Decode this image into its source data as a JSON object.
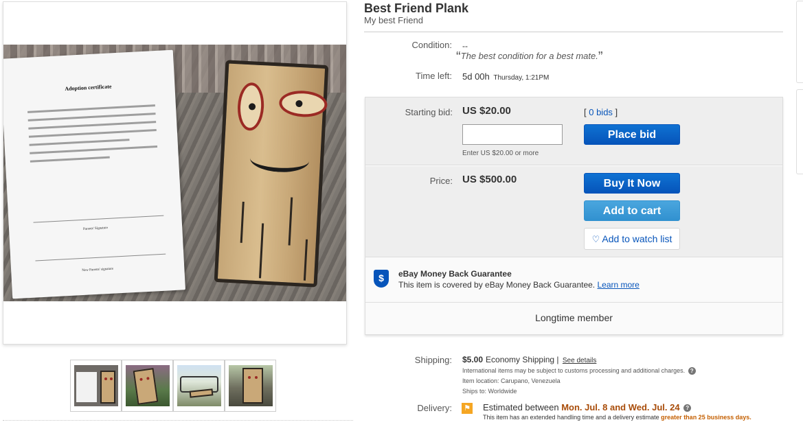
{
  "listing": {
    "title": "Best Friend Plank",
    "subtitle": "My best Friend"
  },
  "images": {
    "main": {
      "certificate_title": "Adoption certificate",
      "parents_signature": "Parents' Signature",
      "new_parents_signature": "New Parents' signature"
    },
    "thumbnails": [
      {
        "name": "certificate-and-plank"
      },
      {
        "name": "plank-in-garden"
      },
      {
        "name": "plank-on-bench"
      },
      {
        "name": "plank-on-balcony"
      }
    ]
  },
  "condition": {
    "label": "Condition:",
    "value": "--",
    "quote": "The best condition for a best mate."
  },
  "time_left": {
    "label": "Time left:",
    "value": "5d 00h",
    "detail": "Thursday, 1:21PM"
  },
  "bidding": {
    "label": "Starting bid:",
    "price": "US $20.00",
    "bids_link": "0 bids",
    "input_value": "",
    "hint": "Enter US $20.00 or more",
    "place_bid": "Place bid"
  },
  "buy": {
    "label": "Price:",
    "price": "US $500.00",
    "buy_it_now": "Buy It Now",
    "add_to_cart": "Add to cart",
    "watch_list": "Add to watch list"
  },
  "guarantee": {
    "title": "eBay Money Back Guarantee",
    "text": "This item is covered by eBay Money Back Guarantee.",
    "learn_more": "Learn more"
  },
  "seller": {
    "member": "Longtime member"
  },
  "shipping": {
    "label": "Shipping:",
    "cost": "$5.00",
    "method": "Economy Shipping",
    "details_link": "See details",
    "note": "International items may be subject to customs processing and additional charges.",
    "location": "Item location:  Carupano, Venezuela",
    "ships_to": "Ships to:  Worldwide"
  },
  "delivery": {
    "label": "Delivery:",
    "prefix": "Estimated between",
    "dates": "Mon. Jul. 8 and Wed. Jul. 24",
    "note_prefix": "This item has an extended handling time and a delivery estimate",
    "note_emph": "greater than 25 business days."
  },
  "colors": {
    "link_blue": "#0654ba",
    "button_blue": "#0654ba",
    "button_light_blue": "#3191d0",
    "delivery_orange": "#a84c09",
    "flag_orange": "#f5a623"
  }
}
